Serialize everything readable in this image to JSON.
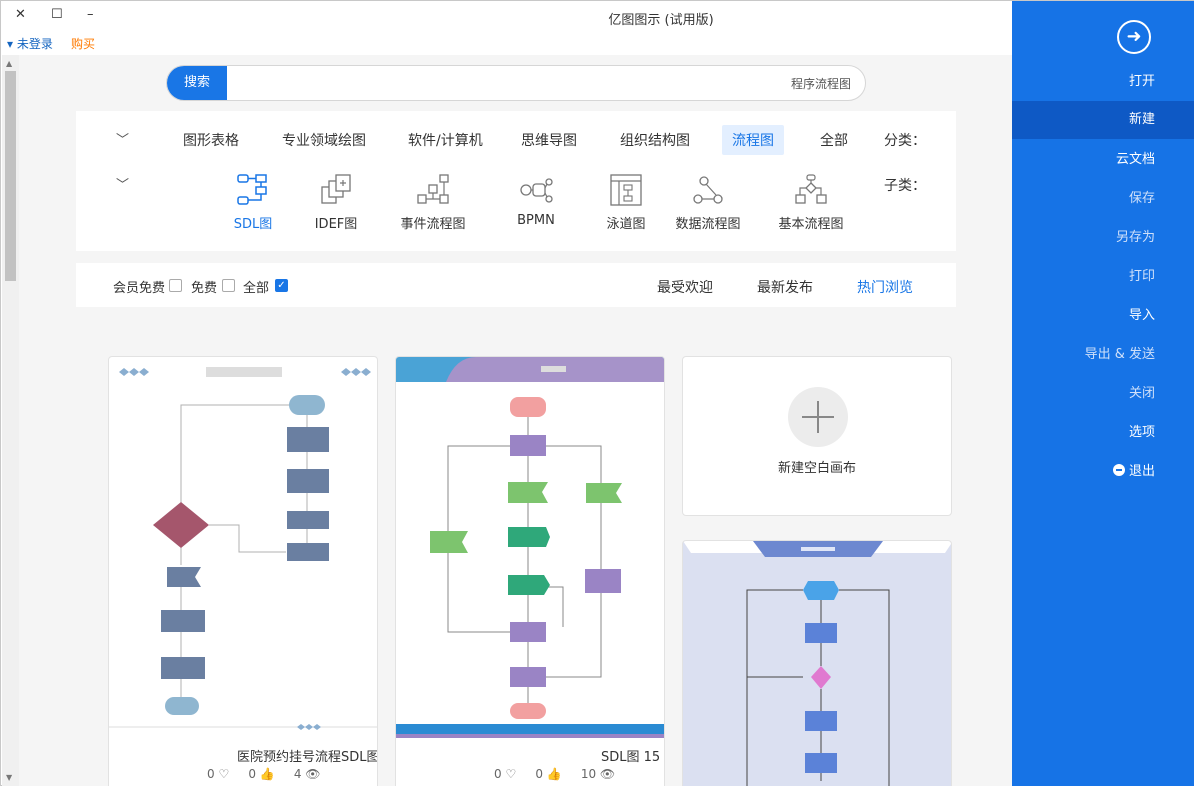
{
  "window": {
    "title": "亿图图示 (试用版)",
    "close": "✕",
    "maximize": "☐",
    "minimize": "–"
  },
  "account": {
    "name": "▾ 未登录",
    "buy": "购买"
  },
  "search": {
    "button": "搜索",
    "value": "程序流程图"
  },
  "categories": {
    "label": "分类：",
    "items": [
      "全部",
      "流程图",
      "组织结构图",
      "思维导图",
      "软件/计算机",
      "专业领域绘图",
      "图形表格"
    ],
    "active": "流程图"
  },
  "subcategories": {
    "label": "子类：",
    "items": [
      "基本流程图",
      "数据流程图",
      "泳道图",
      "BPMN",
      "事件流程图",
      "IDEF图",
      "SDL图"
    ],
    "active": "SDL图"
  },
  "sorting": {
    "items": [
      "热门浏览",
      "最新发布",
      "最受欢迎"
    ],
    "active": "热门浏览"
  },
  "filters": {
    "items": [
      "全部",
      "免费",
      "会员免费"
    ],
    "checked": "全部"
  },
  "cards": {
    "new_blank": "新建空白画布",
    "templates": [
      {
        "title": "医院预约挂号流程SDL图",
        "views": "4",
        "likes": "0",
        "favorites": "0"
      },
      {
        "title": "SDL图 15",
        "views": "10",
        "likes": "0",
        "favorites": "0"
      }
    ]
  },
  "panel": {
    "items": [
      "打开",
      "新建",
      "云文档",
      "保存",
      "另存为",
      "打印",
      "导入",
      "导出 & 发送",
      "关闭",
      "选项",
      "退出"
    ],
    "active": "新建"
  },
  "colors": {
    "accent": "#1976e6",
    "panel": "#1673e6",
    "panel_active": "#0e59c5",
    "buy": "#ff7a00"
  }
}
